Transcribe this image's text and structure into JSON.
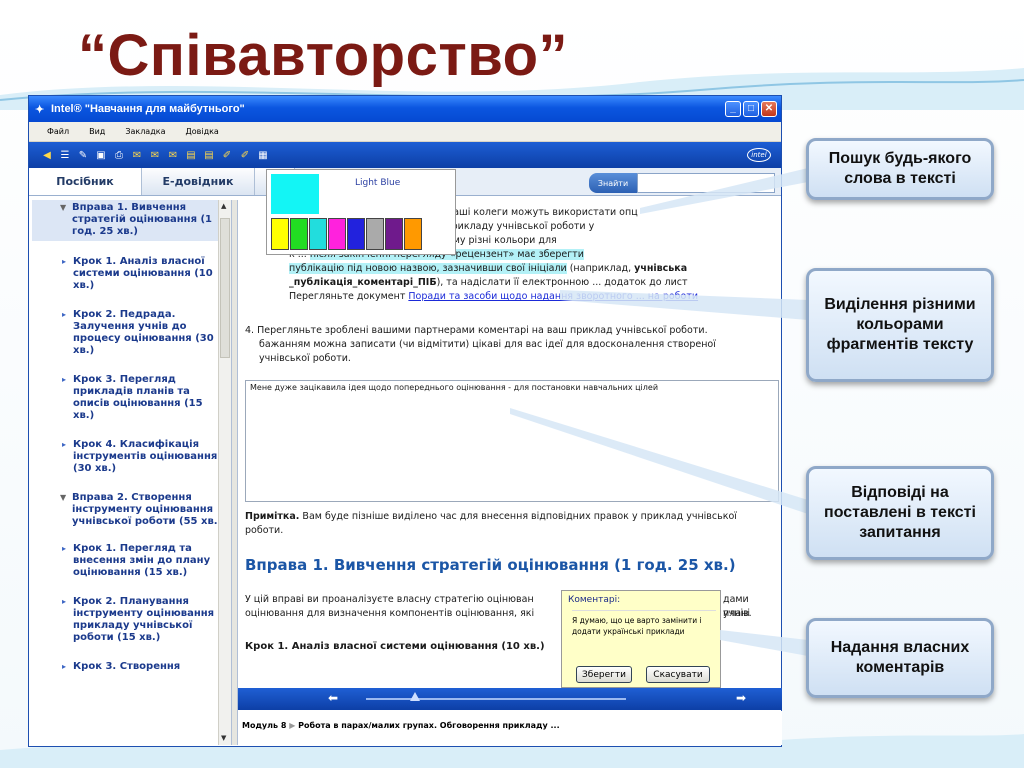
{
  "slide": {
    "title": "“Співавторство”"
  },
  "window": {
    "title": "Intel® \"Навчання для майбутнього\"",
    "menu": [
      "Файл",
      "Вид",
      "Закладка",
      "Довідка"
    ],
    "tabs": [
      "Посібник",
      "Е-довідник",
      "Р"
    ],
    "search_button": "Знайти",
    "search_value": ""
  },
  "sidebar": {
    "items": [
      {
        "type": "top",
        "label": "Вправа 1. Вивчення стратегій оцінювання (1 год. 25 хв.)"
      },
      {
        "type": "step",
        "label": "Крок 1. Аналіз власної системи оцінювання (10 хв.)"
      },
      {
        "type": "step",
        "label": "Крок 2. Педрада. Залучення учнів до процесу оцінювання (30 хв.)"
      },
      {
        "type": "step",
        "label": "Крок 3. Перегляд прикладів планів та описів оцінювання (15 хв.)"
      },
      {
        "type": "step",
        "label": "Крок 4. Класифікація інструментів оцінювання (30 хв.)"
      },
      {
        "type": "sec",
        "label": "Вправа 2. Створення інструменту оцінювання учнівської роботи (55 хв.)"
      },
      {
        "type": "step",
        "label": "Крок 1. Перегляд та внесення змін до плану оцінювання (15 хв.)"
      },
      {
        "type": "step",
        "label": "Крок 2. Планування інструменту оцінювання прикладу учнівської роботи (15 хв.)"
      },
      {
        "type": "step",
        "label": "Крок 3. Створення"
      }
    ]
  },
  "palette": {
    "selected_label": "Light Blue",
    "selected_color": "#13f5f5",
    "swatches": [
      "#ffff00",
      "#22dd22",
      "#22dddd",
      "#ff22dd",
      "#2222dd",
      "#aaaaaa",
      "#6f1a8c",
      "#ff9900"
    ]
  },
  "content": {
    "p1": {
      "l1": "• якщо ви ... роботи - публікація, то ваші колеги можуть використати опц",
      "l2": "Р ... і коментарі прямо в тексті прикладу учнівської роботи у",
      "l3": "в ... ок, використовуючи при цьому різні кольори для",
      "l4a": "к",
      "l4b": "після закінченні перегляду «рецензент» має зберегти",
      "l5a": "публікацію під новою назвою, зазначивши свої ініціали",
      "l5b": " (наприклад, ",
      "l5c": "учнівська",
      "l6a": "_публікація_коментарі_ПІБ",
      "l6b": "), та надіслати її електронною ... додаток до лист",
      "l7a": "Перегляньте документ ",
      "l7b": "Поради та засоби щодо надання зворотного ... на роботи"
    },
    "p4": {
      "l1": "4. Перегляньте зроблені вашими партнерами коментарі на ваш приклад учнівської роботи.",
      "l2": "бажанням можна записати (чи відмітити) цікаві для вас ідеї для вдосконалення створеної",
      "l3": "учнівської роботи."
    },
    "answer_text": "Мене дуже зацікавила ідея щодо попереднього оцінювання - для постановки навчальних цілей",
    "note_label": "Примітка.",
    "note_text": " Вам буде пізніше виділено час для внесення відповідних правок у приклад учнівської",
    "note_text2": "роботи.",
    "heading": "Вправа 1. Вивчення стратегій оцінювання (1 год. 25 хв.)",
    "body1": "У цій вправі ви проаналізуєте власну стратегію оцінюван",
    "body1b": "дами плані",
    "body2": "оцінювання для визначення компонентів оцінювання, які",
    "body2b": "учнів.",
    "step_title": "Крок 1. Аналіз власної системи оцінювання (10 хв.)"
  },
  "comment": {
    "title": "Коментарі:",
    "text": "Я думаю, що це варто замінити і додати українські приклади",
    "save": "Зберегти",
    "cancel": "Скасувати"
  },
  "status": {
    "module": "Модуль 8",
    "path": "Робота в парах/малих групах. Обговорення прикладу ..."
  },
  "callouts": {
    "search": "Пошук будь-якого слова в тексті",
    "highlight": "Виділення різними кольорами фрагментів тексту",
    "answers": "Відповіді на поставлені в тексті запитання",
    "comments": "Надання власних коментарів"
  }
}
